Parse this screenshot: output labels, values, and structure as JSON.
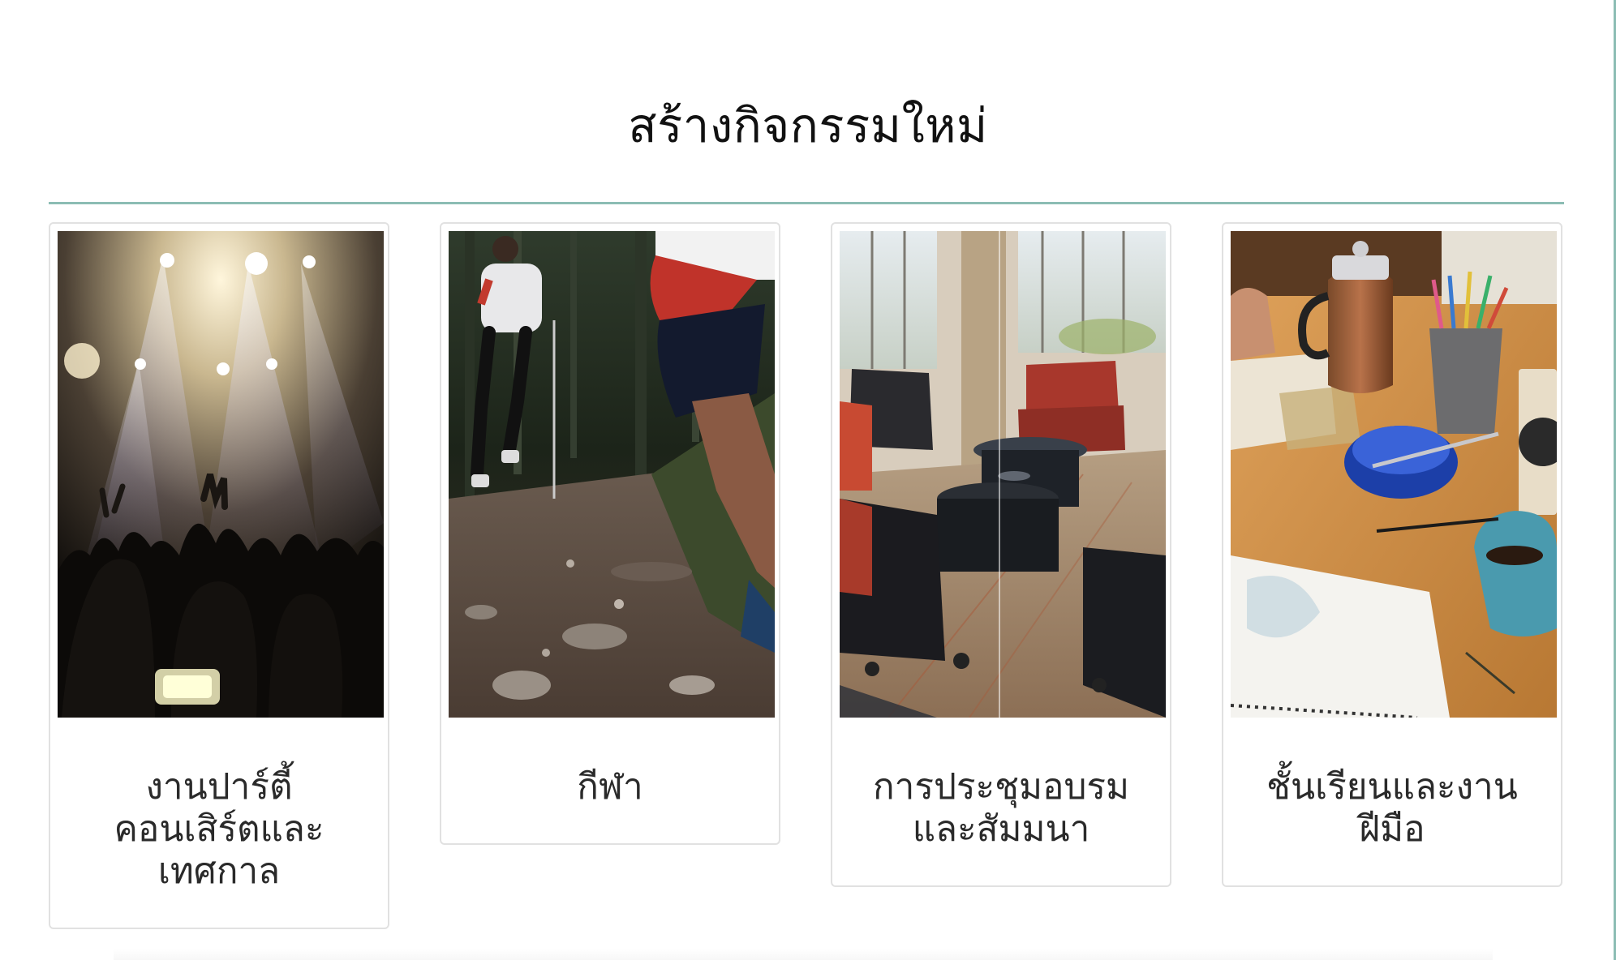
{
  "page": {
    "title": "สร้างกิจกรรมใหม่"
  },
  "colors": {
    "accent": "#8cbdb4",
    "card_border": "#e1e1e1",
    "text": "#2a2a2a"
  },
  "categories": [
    {
      "label": "งานปาร์ตี้ คอนเสิร์ตและ เทศกาล",
      "image_subject": "concert-crowd-photo"
    },
    {
      "label": "กีฬา",
      "image_subject": "trail-running-photo"
    },
    {
      "label": "การประชุมอบรม และสัมมนา",
      "image_subject": "meeting-lounge-photo"
    },
    {
      "label": "ชั้นเรียนและงาน ฝีมือ",
      "image_subject": "crafts-desk-photo"
    }
  ]
}
